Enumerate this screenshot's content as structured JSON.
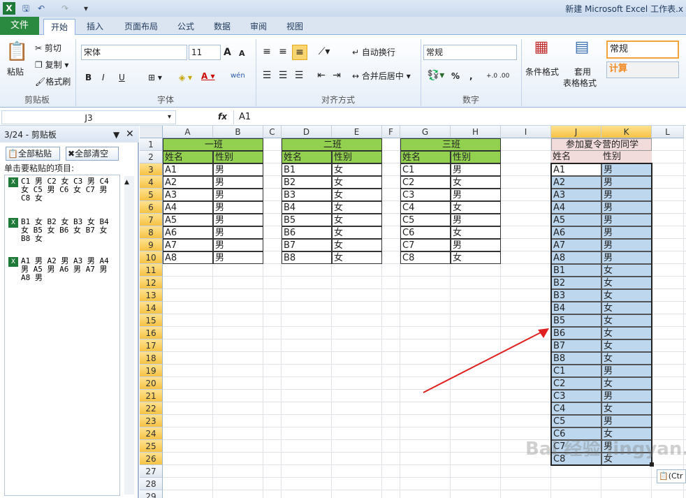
{
  "titlebar": {
    "title": "新建 Microsoft Excel 工作表.x",
    "app_icon": "excel-icon"
  },
  "tabs": [
    "文件",
    "开始",
    "插入",
    "页面布局",
    "公式",
    "数据",
    "审阅",
    "视图"
  ],
  "ribbon": {
    "clipboard": {
      "paste": "粘贴",
      "cut": "剪切",
      "copy": "复制",
      "format_painter": "格式刷",
      "group": "剪贴板"
    },
    "font": {
      "name": "宋体",
      "size": "11",
      "grow": "A",
      "shrink": "A",
      "bold": "B",
      "italic": "I",
      "underline": "U",
      "wen": "wén",
      "group": "字体"
    },
    "alignment": {
      "wrap": "自动换行",
      "merge": "合并后居中",
      "group": "对齐方式"
    },
    "number": {
      "format": "常规",
      "percent": "%",
      "comma": ",",
      "inc": "+.0 .00",
      "dec": ".00 +.0",
      "group": "数字"
    },
    "styles": {
      "conditional": "条件格式",
      "table": "套用",
      "table2": "表格格式",
      "normal": "常规",
      "calc": "计算"
    }
  },
  "formula_bar": {
    "name_box": "J3",
    "fx": "fx",
    "value": "A1"
  },
  "clipboard_pane": {
    "title": "3/24 - 剪贴板",
    "paste_all": "全部粘贴",
    "clear_all": "全部清空",
    "hint": "单击要粘贴的项目:",
    "items": [
      [
        "C1 男 C2 女 C3 男 C4",
        "女 C5 男 C6 女 C7 男",
        "C8 女"
      ],
      [
        "B1 女 B2 女 B3 女 B4",
        "女 B5 女 B6 女 B7 女",
        "B8 女"
      ],
      [
        "A1 男 A2 男 A3 男 A4",
        "男 A5 男 A6 男 A7 男",
        "A8 男"
      ]
    ]
  },
  "sheet": {
    "columns": [
      "A",
      "B",
      "C",
      "D",
      "E",
      "F",
      "G",
      "H",
      "I",
      "J",
      "K",
      "L"
    ],
    "rows": [
      "1",
      "2",
      "3",
      "4",
      "5",
      "6",
      "7",
      "8",
      "9",
      "10",
      "11",
      "12",
      "13",
      "14",
      "15",
      "16",
      "17",
      "18",
      "19",
      "20",
      "21",
      "22",
      "23",
      "24",
      "25",
      "26",
      "27",
      "28",
      "29"
    ],
    "class1": {
      "title": "一班",
      "h_name": "姓名",
      "h_sex": "性别",
      "names": [
        "A1",
        "A2",
        "A3",
        "A4",
        "A5",
        "A6",
        "A7",
        "A8"
      ],
      "sexes": [
        "男",
        "男",
        "男",
        "男",
        "男",
        "男",
        "男",
        "男"
      ]
    },
    "class2": {
      "title": "二班",
      "h_name": "姓名",
      "h_sex": "性别",
      "names": [
        "B1",
        "B2",
        "B3",
        "B4",
        "B5",
        "B6",
        "B7",
        "B8"
      ],
      "sexes": [
        "女",
        "女",
        "女",
        "女",
        "女",
        "女",
        "女",
        "女"
      ]
    },
    "class3": {
      "title": "三班",
      "h_name": "姓名",
      "h_sex": "性别",
      "names": [
        "C1",
        "C2",
        "C3",
        "C4",
        "C5",
        "C6",
        "C7",
        "C8"
      ],
      "sexes": [
        "男",
        "女",
        "男",
        "女",
        "男",
        "女",
        "男",
        "女"
      ]
    },
    "camp": {
      "title": "参加夏令营的同学",
      "h_name": "姓名",
      "h_sex": "性别",
      "names": [
        "A1",
        "A2",
        "A3",
        "A4",
        "A5",
        "A6",
        "A7",
        "A8",
        "B1",
        "B2",
        "B3",
        "B4",
        "B5",
        "B6",
        "B7",
        "B8",
        "C1",
        "C2",
        "C3",
        "C4",
        "C5",
        "C6",
        "C7",
        "C8"
      ],
      "sexes": [
        "男",
        "男",
        "男",
        "男",
        "男",
        "男",
        "男",
        "男",
        "女",
        "女",
        "女",
        "女",
        "女",
        "女",
        "女",
        "女",
        "男",
        "女",
        "男",
        "女",
        "男",
        "女",
        "男",
        "女"
      ]
    },
    "paste_options": "(Ctr",
    "watermark": "Bai 经验 jingyan.baidu.com"
  },
  "colors": {
    "header_green": "#92d050",
    "camp_pink": "#f2dcdb",
    "selection_blue": "#bdd7ee",
    "arrow_red": "#e02020"
  }
}
